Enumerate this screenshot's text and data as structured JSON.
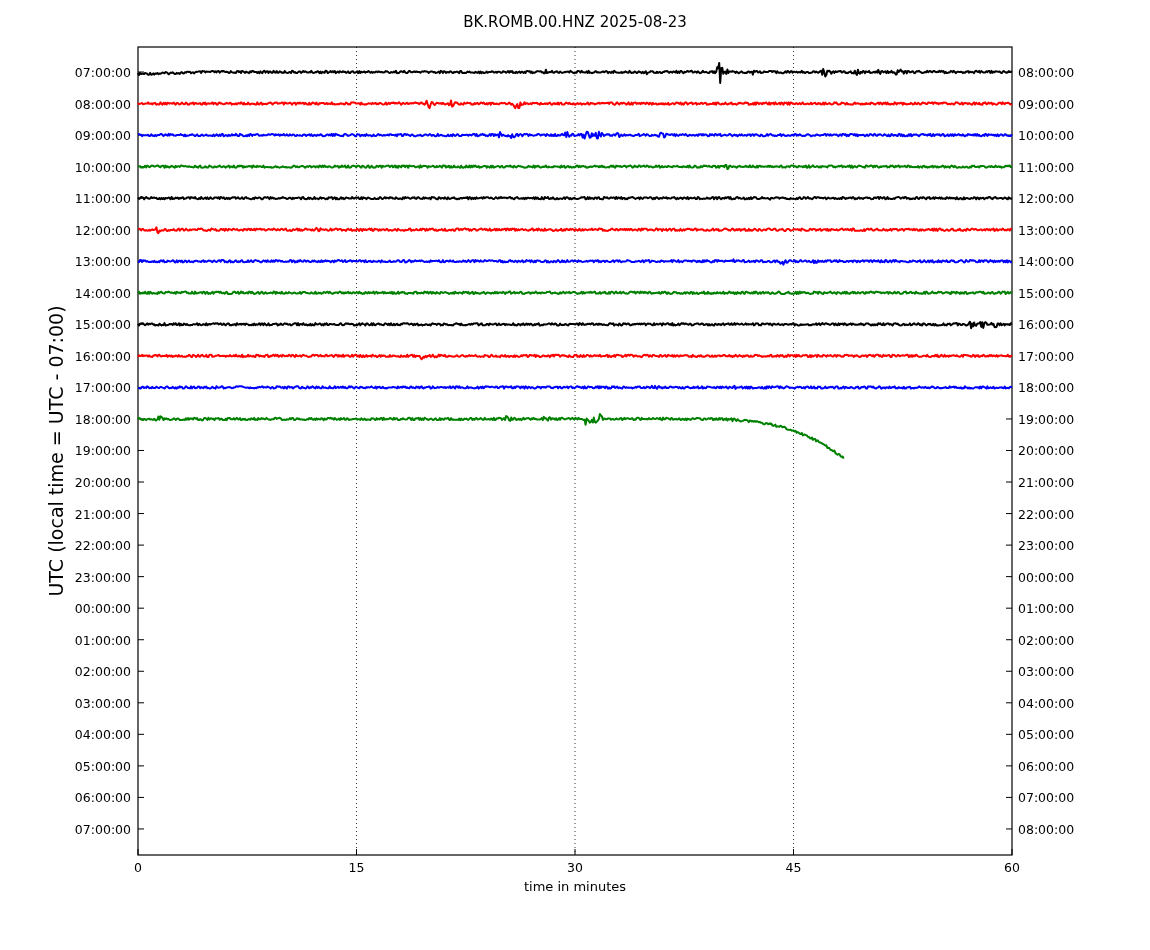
{
  "title": "BK.ROMB.00.HNZ 2025-08-23",
  "y_axis": {
    "label": "UTC (local time = UTC - 07:00)",
    "left_ticks": [
      "07:00:00",
      "08:00:00",
      "09:00:00",
      "10:00:00",
      "11:00:00",
      "12:00:00",
      "13:00:00",
      "14:00:00",
      "15:00:00",
      "16:00:00",
      "17:00:00",
      "18:00:00",
      "19:00:00",
      "20:00:00",
      "21:00:00",
      "22:00:00",
      "23:00:00",
      "00:00:00",
      "01:00:00",
      "02:00:00",
      "03:00:00",
      "04:00:00",
      "05:00:00",
      "06:00:00",
      "07:00:00"
    ],
    "right_ticks": [
      "08:00:00",
      "09:00:00",
      "10:00:00",
      "11:00:00",
      "12:00:00",
      "13:00:00",
      "14:00:00",
      "15:00:00",
      "16:00:00",
      "17:00:00",
      "18:00:00",
      "19:00:00",
      "20:00:00",
      "21:00:00",
      "22:00:00",
      "23:00:00",
      "00:00:00",
      "01:00:00",
      "02:00:00",
      "03:00:00",
      "04:00:00",
      "05:00:00",
      "06:00:00",
      "07:00:00",
      "08:00:00"
    ]
  },
  "x_axis": {
    "label": "time in minutes",
    "ticks": [
      "0",
      "15",
      "30",
      "45",
      "60"
    ]
  },
  "traces": [
    {
      "color": "#000000"
    },
    {
      "color": "#ff0000"
    },
    {
      "color": "#0000ff"
    },
    {
      "color": "#008000"
    },
    {
      "color": "#000000"
    },
    {
      "color": "#ff0000"
    },
    {
      "color": "#0000ff"
    },
    {
      "color": "#008000"
    },
    {
      "color": "#000000"
    },
    {
      "color": "#ff0000"
    },
    {
      "color": "#0000ff"
    },
    {
      "color": "#008000"
    }
  ]
}
